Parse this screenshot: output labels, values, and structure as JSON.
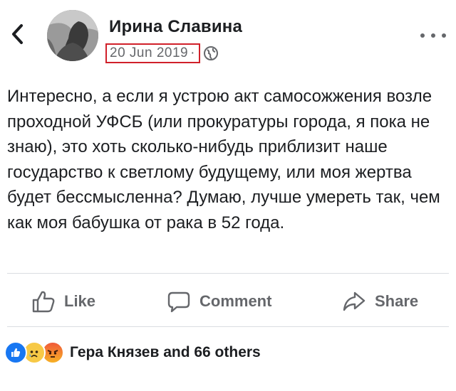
{
  "post": {
    "author": "Ирина Славина",
    "date": "20 Jun 2019",
    "separator": "·",
    "privacy_icon": "globe-icon",
    "text": "Интересно, а если я устрою акт самосожжения возле проходной УФСБ (или прокуратуры города, я пока не знаю), это хоть сколько-нибудь приблизит наше государство к светлому будущему, или моя жертва будет бессмысленна? Думаю, лучше умереть так, чем как моя бабушка от рака в 52 года."
  },
  "actions": {
    "like_label": "Like",
    "comment_label": "Comment",
    "share_label": "Share"
  },
  "reactions": {
    "icons": [
      "like-icon",
      "sad-icon",
      "angry-icon"
    ],
    "summary": "Гера Князев and 66 others"
  },
  "colors": {
    "highlight_box": "#d0202a",
    "secondary_text": "#65676b",
    "like_blue": "#1877f2"
  }
}
